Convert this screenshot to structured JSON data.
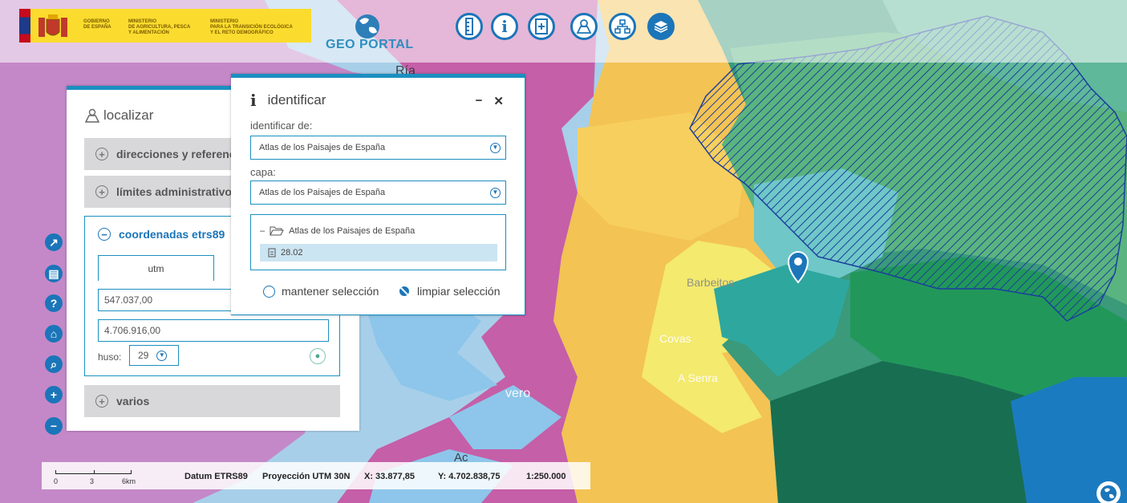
{
  "colors": {
    "accent": "#1b8fc0",
    "brand_blue": "#1b75b9",
    "gov_yellow": "#fbdc2e"
  },
  "header": {
    "gov_line1": "GOBIERNO\nDE ESPAÑA",
    "gov_line2": "MINISTERIO\nDE AGRICULTURA, PESCA\nY ALIMENTACIÓN",
    "gov_line3": "MINISTERIO\nPARA LA TRANSICIÓN ECOLÓGICA\nY EL RETO DEMOGRÁFICO",
    "title": "GEO PORTAL",
    "tools": [
      "ruler-icon",
      "info-icon",
      "bookmark-icon",
      "map-search-icon",
      "sitemap-icon",
      "layers-icon"
    ]
  },
  "sidebar": {
    "tools": [
      "share-icon",
      "save-icon",
      "help-icon",
      "home-icon",
      "zoom-search-icon",
      "zoom-in-icon",
      "zoom-out-icon"
    ]
  },
  "localizar": {
    "title": "localizar",
    "sections": {
      "direcciones": "direcciones y referencia",
      "limites": "límites administrativos",
      "coordenadas": "coordenadas etrs89",
      "varios": "varios"
    },
    "tab_utm": "utm",
    "x_value": "547.037,00",
    "y_value": "4.706.916,00",
    "huso_label": "huso:",
    "huso_value": "29"
  },
  "identificar": {
    "title": "identificar",
    "from_label": "identificar de:",
    "from_value": "Atlas de los Paisajes de España",
    "layer_label": "capa:",
    "layer_value": "Atlas de los Paisajes de España",
    "tree_root": "Atlas de los Paisajes de España",
    "tree_item": "28.02",
    "keep_selection": "mantener selección",
    "clear_selection": "limpiar selección"
  },
  "status": {
    "scale_0": "0",
    "scale_3": "3",
    "scale_6": "6km",
    "datum": "Datum ETRS89",
    "projection": "Proyección UTM 30N",
    "x": "X: 33.877,85",
    "y": "Y: 4.702.838,75",
    "scale": "1:250.000"
  },
  "map_labels": {
    "ria": "Ría",
    "barbeitos": "Barbeitos",
    "covas": "Covas",
    "a_senra": "A Senra",
    "vivero": "vero",
    "ac": "Ac"
  }
}
